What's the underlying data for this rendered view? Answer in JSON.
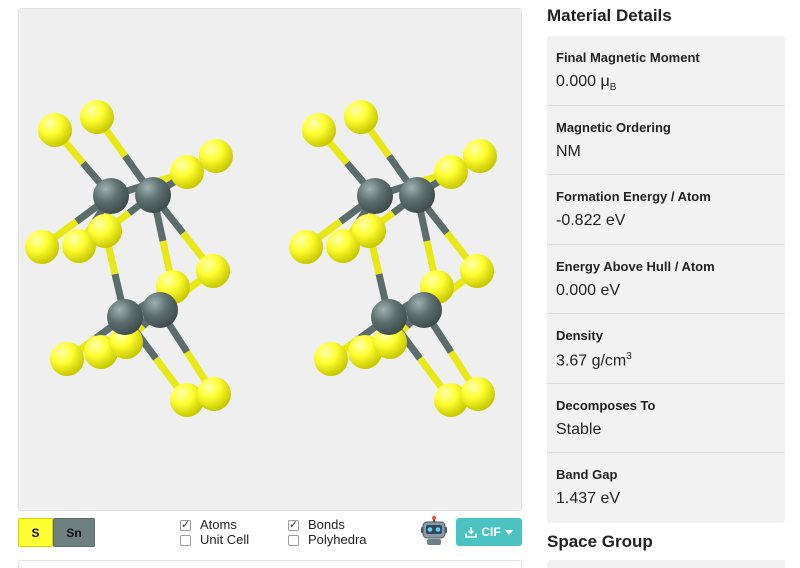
{
  "viewer": {
    "elements": [
      {
        "symbol": "S",
        "color": "#ffff33"
      },
      {
        "symbol": "Sn",
        "color": "#6f8080"
      }
    ],
    "options": {
      "atoms": {
        "label": "Atoms",
        "checked": true
      },
      "bonds": {
        "label": "Bonds",
        "checked": true
      },
      "unit_cell": {
        "label": "Unit Cell",
        "checked": false
      },
      "polyhedra": {
        "label": "Polyhedra",
        "checked": false
      }
    },
    "robot_icon": "robot-icon",
    "download": {
      "label": "CIF",
      "icon": "download-icon"
    }
  },
  "details": {
    "title": "Material Details",
    "rows": [
      {
        "label": "Final Magnetic Moment",
        "value": "0.000 μ",
        "sub": "B"
      },
      {
        "label": "Magnetic Ordering",
        "value": "NM"
      },
      {
        "label": "Formation Energy / Atom",
        "value": "-0.822 eV"
      },
      {
        "label": "Energy Above Hull / Atom",
        "value": "0.000 eV"
      },
      {
        "label": "Density",
        "value": "3.67 g/cm",
        "sup": "3"
      },
      {
        "label": "Decomposes To",
        "value": "Stable"
      },
      {
        "label": "Band Gap",
        "value": "1.437 eV"
      }
    ]
  },
  "space_group": {
    "title": "Space Group"
  }
}
